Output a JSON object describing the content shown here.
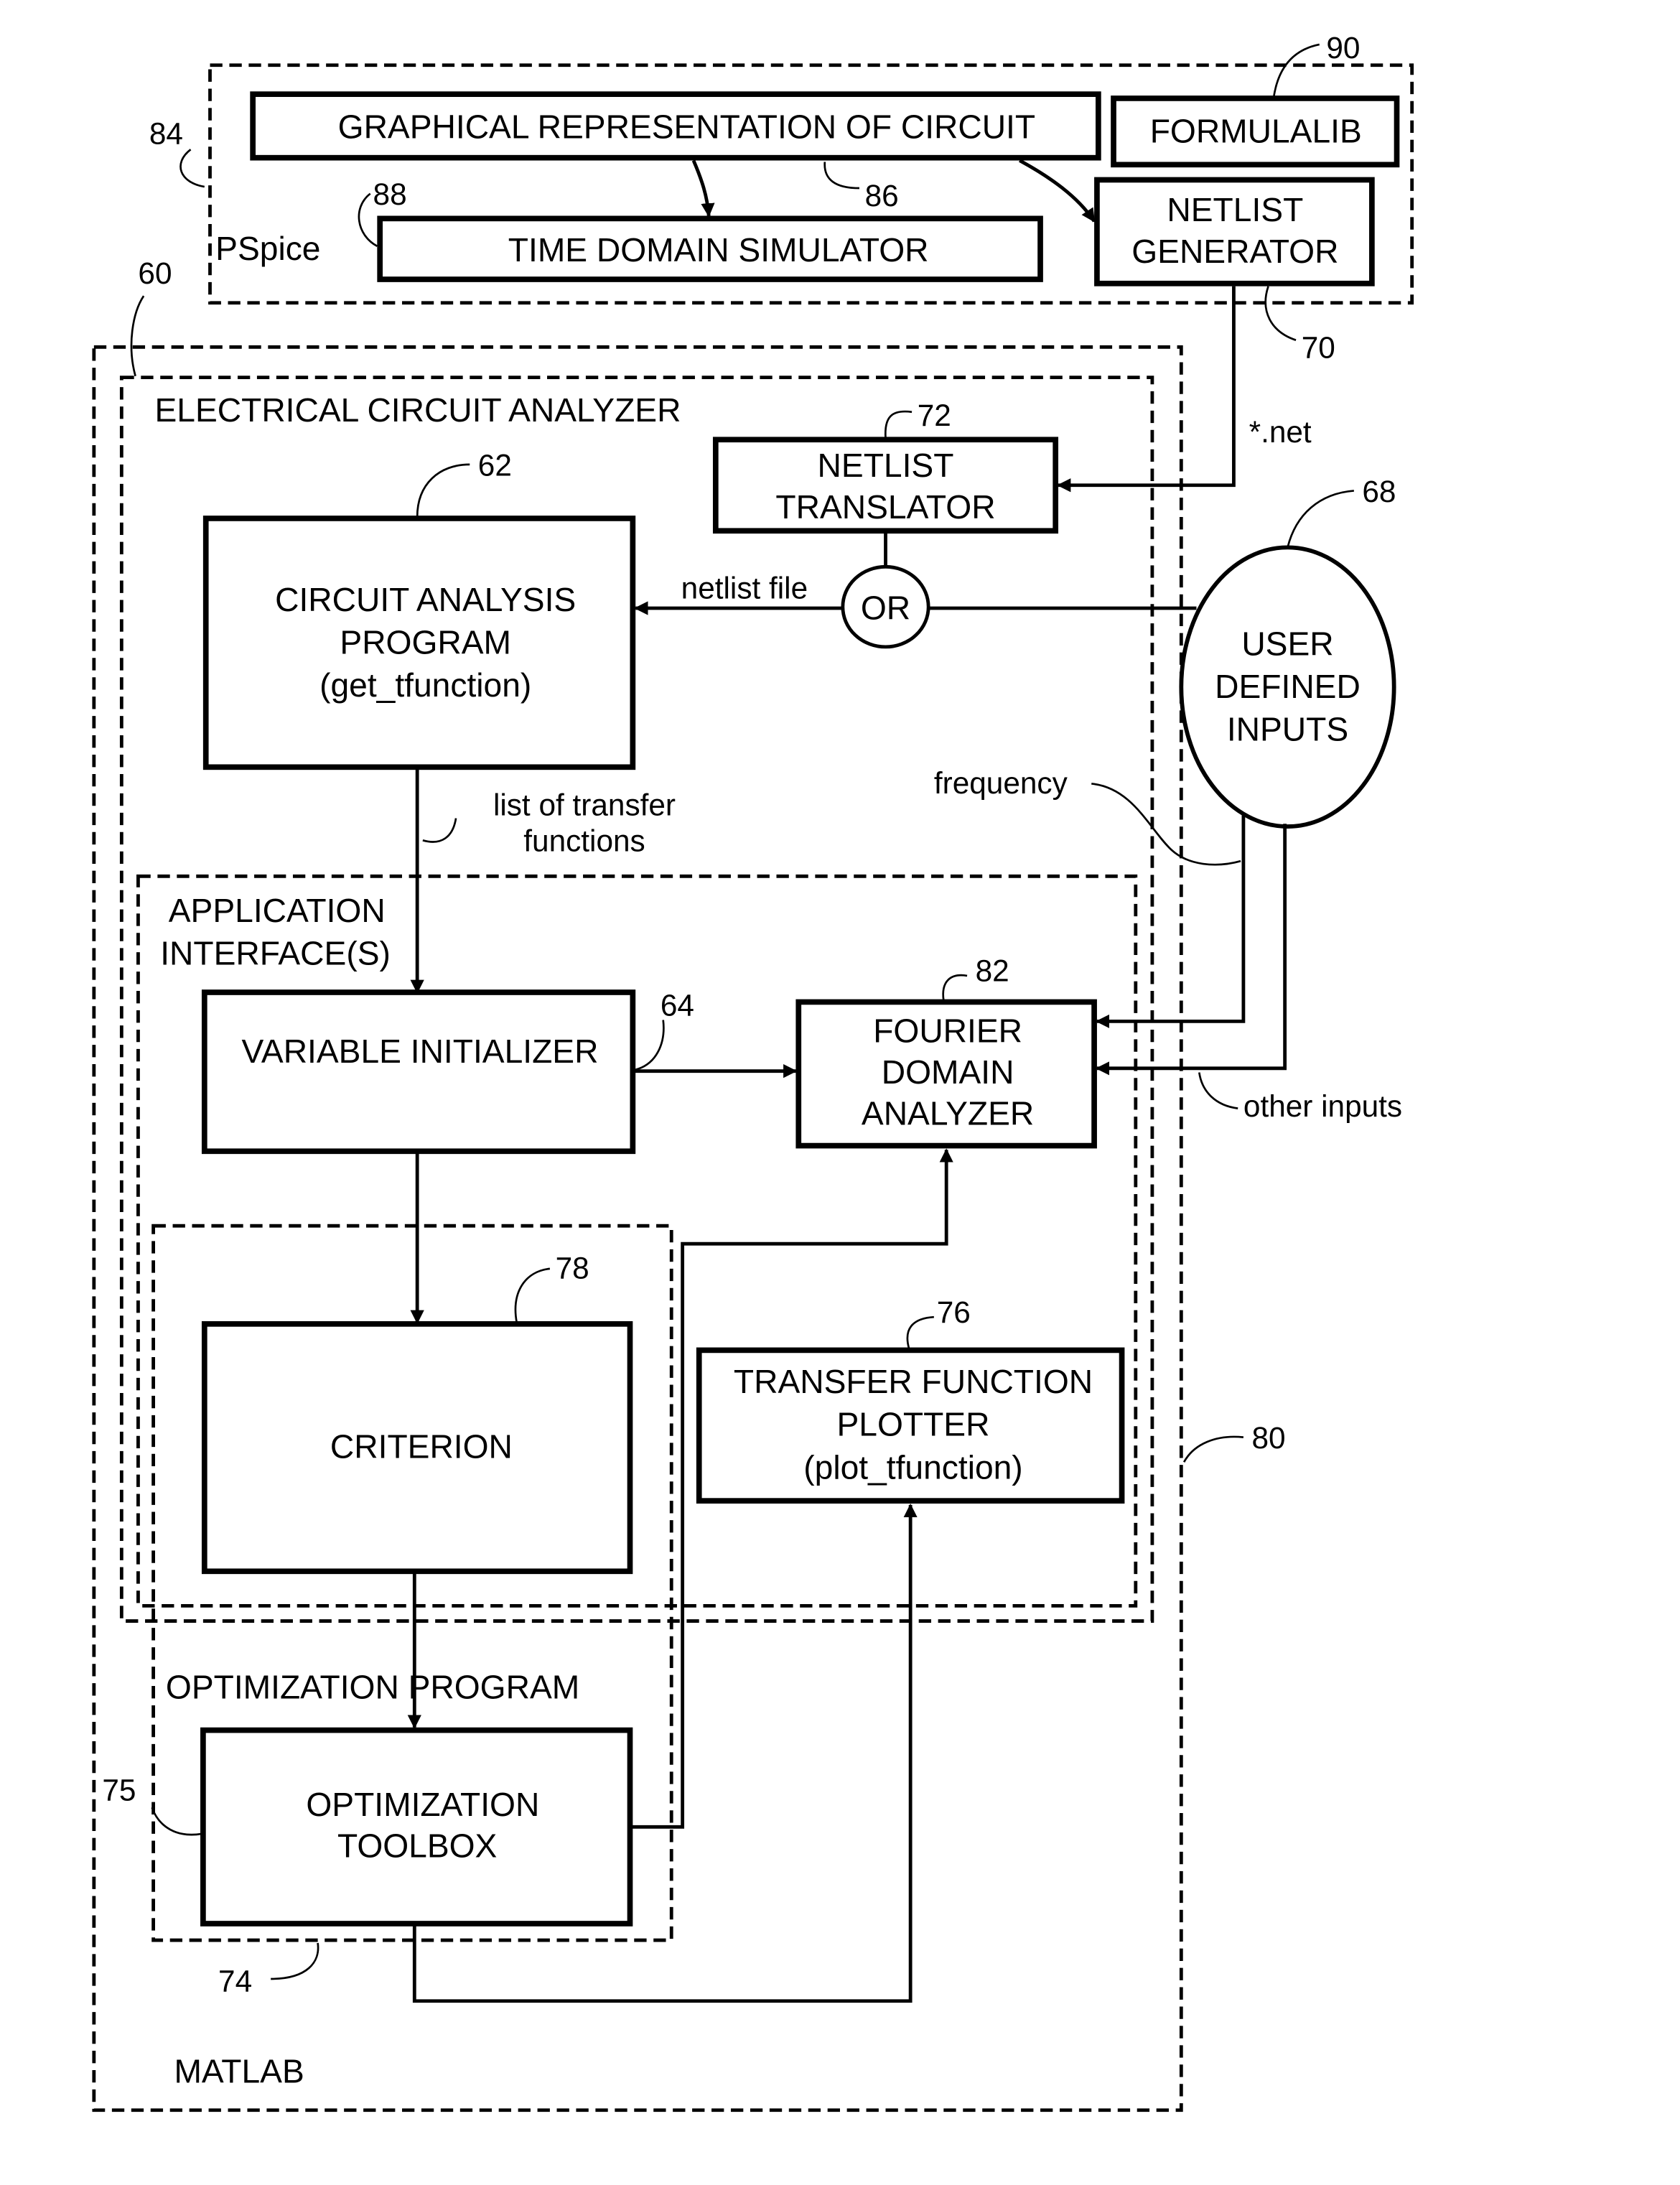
{
  "containers": {
    "pspice": {
      "label": "PSpice",
      "ref": "84"
    },
    "matlab": {
      "label": "MATLAB",
      "ref": "80"
    },
    "circuit_analyzer": {
      "label": "ELECTRICAL CIRCUIT ANALYZER",
      "ref": "60"
    },
    "app_interface": {
      "label_line1": "APPLICATION",
      "label_line2": "INTERFACE(S)"
    },
    "optimization_program": {
      "label": "OPTIMIZATION  PROGRAM",
      "ref": "74"
    }
  },
  "blocks": {
    "graphical": {
      "label": "GRAPHICAL REPRESENTATION OF CIRCUIT",
      "ref": "86"
    },
    "formulalib": {
      "label": "FORMULALIB",
      "ref": "90"
    },
    "time_domain": {
      "label": "TIME DOMAIN SIMULATOR",
      "ref": "88"
    },
    "netlist_generator": {
      "line1": "NETLIST",
      "line2": "GENERATOR",
      "ref": "70"
    },
    "netlist_translator": {
      "line1": "NETLIST",
      "line2": "TRANSLATOR",
      "ref": "72"
    },
    "circuit_analysis": {
      "line1": "CIRCUIT ANALYSIS",
      "line2": "PROGRAM",
      "line3": "(get_tfunction)",
      "ref": "62"
    },
    "or_gate": {
      "label": "OR"
    },
    "user_inputs": {
      "line1": "USER",
      "line2": "DEFINED",
      "line3": "INPUTS",
      "ref": "68"
    },
    "variable_initializer": {
      "label": "VARIABLE INITIALIZER",
      "ref": "64"
    },
    "fourier": {
      "line1": "FOURIER",
      "line2": "DOMAIN",
      "line3": "ANALYZER",
      "ref": "82"
    },
    "criterion": {
      "label": "CRITERION",
      "ref": "78"
    },
    "tf_plotter": {
      "line1": "TRANSFER FUNCTION",
      "line2": "PLOTTER",
      "line3": "(plot_tfunction)",
      "ref": "76"
    },
    "opt_toolbox": {
      "line1": "OPTIMIZATION",
      "line2": "TOOLBOX",
      "ref": "75"
    }
  },
  "edge_labels": {
    "net": "*.net",
    "netlist_file": "netlist file",
    "list_tf_1": "list of transfer",
    "list_tf_2": "functions",
    "frequency": "frequency",
    "other_inputs": "other inputs"
  }
}
